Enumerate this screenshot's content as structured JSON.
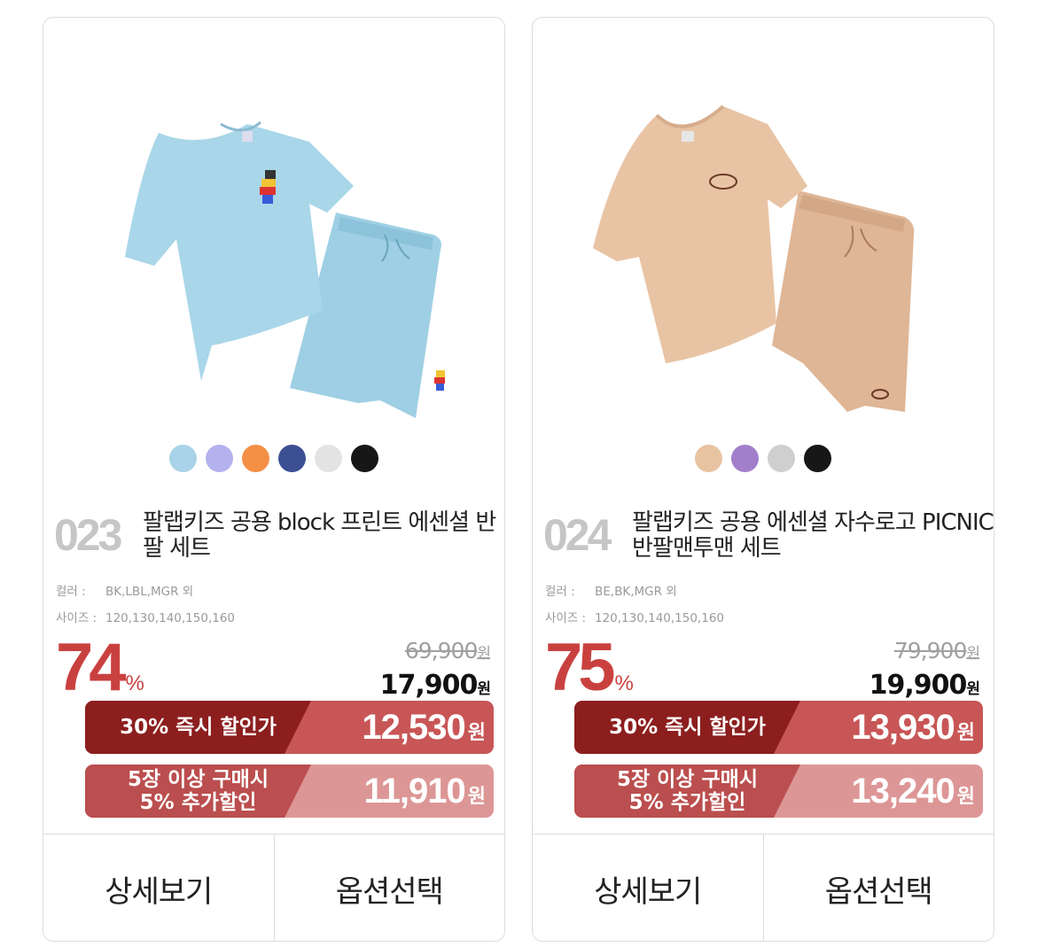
{
  "products": [
    {
      "number": "023",
      "title": "팔랩키즈 공용 block 프린트 에센셜 반팔 세트",
      "color_label": "컬러 :",
      "colors": "BK,LBL,MGR 외",
      "size_label": "사이즈 :",
      "sizes": "120,130,140,150,160",
      "discount_pct": "74",
      "pct_sign": "%",
      "original_price": "69,900",
      "sale_price": "17,900",
      "currency": "원",
      "instant_label": "30% 즉시 할인가",
      "instant_price": "12,530",
      "bulk_label_1": "5장 이상 구매시",
      "bulk_label_2": "5% 추가할인",
      "bulk_price": "11,910",
      "detail_button": "상세보기",
      "option_button": "옵션선택",
      "swatch_colors": [
        "#a9d3e8",
        "#b3b2ee",
        "#f39046",
        "#3c4f93",
        "#e3e3e3",
        "#171717"
      ],
      "garment_color": "#a9d6e9"
    },
    {
      "number": "024",
      "title": "팔랩키즈 공용 에센셜 자수로고 PICNIC 반팔맨투맨 세트",
      "color_label": "컬러 :",
      "colors": "BE,BK,MGR 외",
      "size_label": "사이즈 :",
      "sizes": "120,130,140,150,160",
      "discount_pct": "75",
      "pct_sign": "%",
      "original_price": "79,900",
      "sale_price": "19,900",
      "currency": "원",
      "instant_label": "30% 즉시 할인가",
      "instant_price": "13,930",
      "bulk_label_1": "5장 이상 구매시",
      "bulk_label_2": "5% 추가할인",
      "bulk_price": "13,240",
      "detail_button": "상세보기",
      "option_button": "옵션선택",
      "swatch_colors": [
        "#e8c3a2",
        "#a27fcb",
        "#cfcfcf",
        "#171717"
      ],
      "garment_color": "#e8c4a5"
    }
  ],
  "colors": {
    "accent_red": "#c9413f",
    "band_dark": "#8c1e1e",
    "band_mid": "#b84b4b",
    "band_light": "#d88f8f"
  }
}
